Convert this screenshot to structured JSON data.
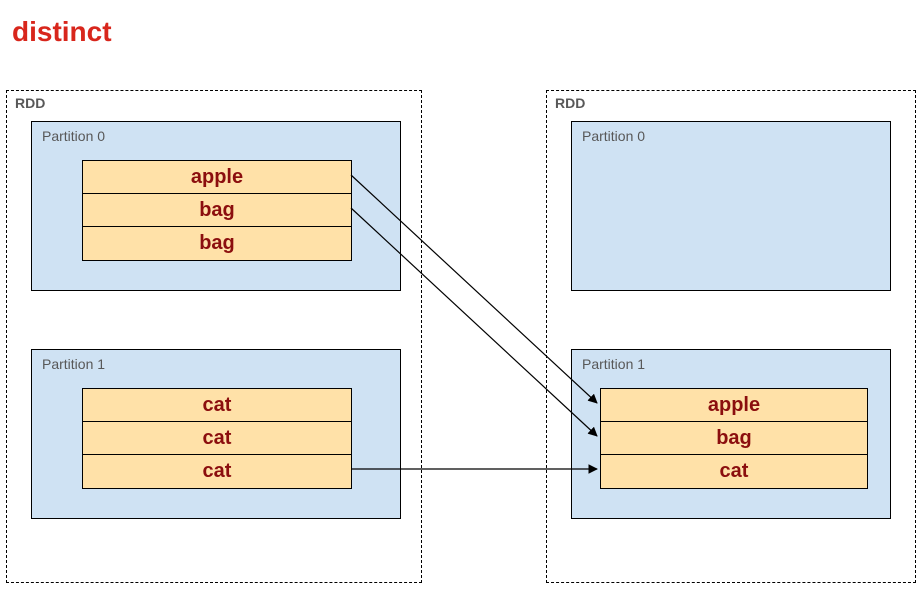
{
  "title": "distinct",
  "left_rdd": {
    "label": "RDD",
    "partitions": [
      {
        "label": "Partition 0",
        "rows": [
          "apple",
          "bag",
          "bag"
        ]
      },
      {
        "label": "Partition 1",
        "rows": [
          "cat",
          "cat",
          "cat"
        ]
      }
    ]
  },
  "right_rdd": {
    "label": "RDD",
    "partitions": [
      {
        "label": "Partition 0",
        "rows": []
      },
      {
        "label": "Partition 1",
        "rows": [
          "apple",
          "bag",
          "cat"
        ]
      }
    ]
  },
  "chart_data": {
    "type": "diagram",
    "operation": "distinct",
    "input": {
      "rdd": [
        {
          "partition": 0,
          "values": [
            "apple",
            "bag",
            "bag"
          ]
        },
        {
          "partition": 1,
          "values": [
            "cat",
            "cat",
            "cat"
          ]
        }
      ]
    },
    "output": {
      "rdd": [
        {
          "partition": 0,
          "values": []
        },
        {
          "partition": 1,
          "values": [
            "apple",
            "bag",
            "cat"
          ]
        }
      ]
    },
    "arrows": [
      {
        "from": "left.p0.row0",
        "to": "right.p1.row0"
      },
      {
        "from": "left.p0.row1",
        "to": "right.p1.row1"
      },
      {
        "from": "left.p1.row2",
        "to": "right.p1.row2"
      }
    ]
  }
}
